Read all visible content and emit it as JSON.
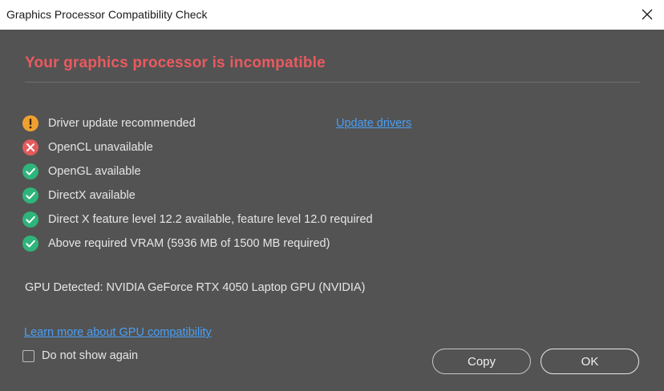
{
  "window": {
    "title": "Graphics Processor Compatibility Check",
    "close_icon": "close-icon"
  },
  "heading": {
    "text": "Your graphics processor is incompatible",
    "color": "#ea5a5f"
  },
  "checks": [
    {
      "label": "Driver update recommended",
      "status": "warning",
      "icon": "warning-icon",
      "color": "#f0a030"
    },
    {
      "label": "OpenCL unavailable",
      "status": "error",
      "icon": "error-icon",
      "color": "#e35b5b"
    },
    {
      "label": "OpenGL available",
      "status": "ok",
      "icon": "check-icon",
      "color": "#2fb47a"
    },
    {
      "label": "DirectX available",
      "status": "ok",
      "icon": "check-icon",
      "color": "#2fb47a"
    },
    {
      "label": "Direct X feature level 12.2 available, feature level 12.0 required",
      "status": "ok",
      "icon": "check-icon",
      "color": "#2fb47a"
    },
    {
      "label": "Above required VRAM (5936 MB of 1500 MB required)",
      "status": "ok",
      "icon": "check-icon",
      "color": "#2fb47a"
    }
  ],
  "update_drivers_link": "Update drivers",
  "gpu_detected": "GPU Detected: NVIDIA GeForce RTX 4050 Laptop GPU (NVIDIA)",
  "learn_more_link": "Learn more about GPU compatibility",
  "do_not_show": {
    "label": "Do not show again",
    "checked": false
  },
  "buttons": {
    "copy": "Copy",
    "ok": "OK"
  }
}
